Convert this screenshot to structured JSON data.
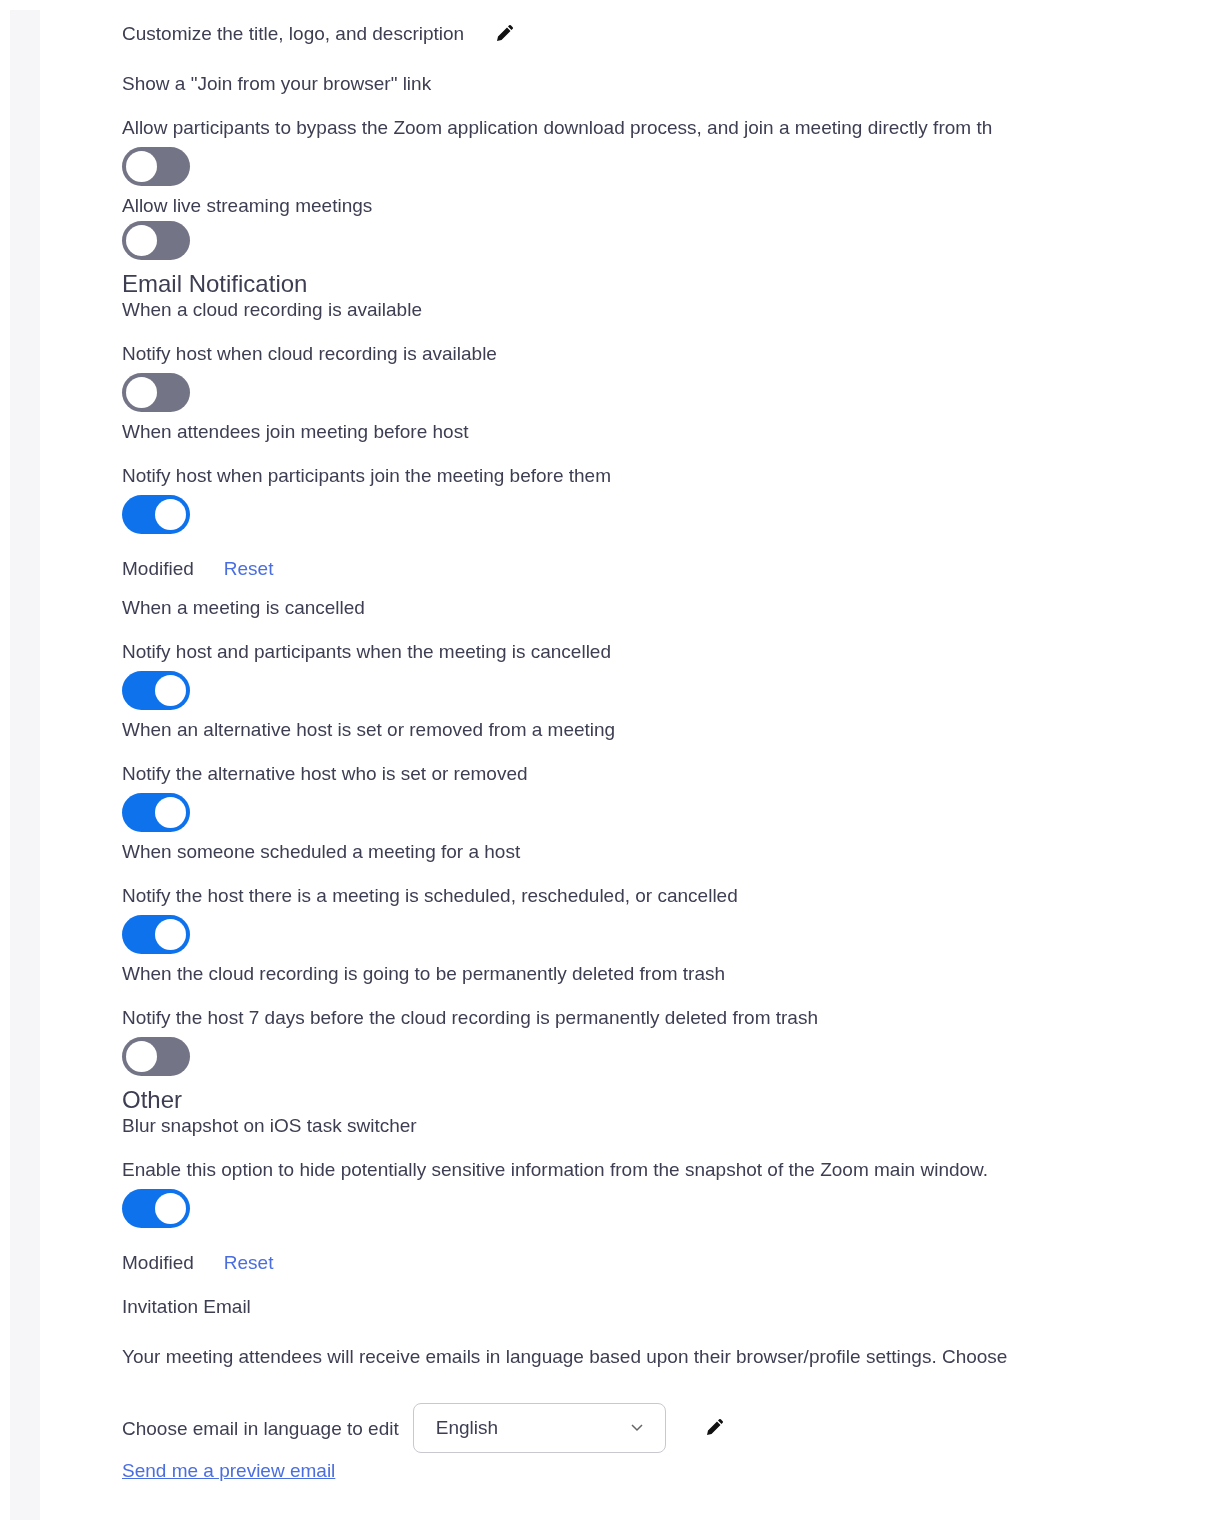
{
  "items": [
    {
      "kind": "edit",
      "title": "Customize the title, logo, and description"
    },
    {
      "kind": "setting",
      "title": "Show a \"Join from your browser\" link",
      "description": "Allow participants to bypass the Zoom application download process, and join a meeting directly from th",
      "on": false
    },
    {
      "kind": "setting",
      "title": "Allow live streaming meetings",
      "on": false
    },
    {
      "kind": "heading",
      "title": "Email Notification"
    },
    {
      "kind": "setting",
      "title": "When a cloud recording is available",
      "description": "Notify host when cloud recording is available",
      "on": false
    },
    {
      "kind": "setting",
      "title": "When attendees join meeting before host",
      "description": "Notify host when participants join the meeting before them",
      "on": true,
      "modified": "Modified",
      "reset": "Reset"
    },
    {
      "kind": "setting",
      "title": "When a meeting is cancelled",
      "description": "Notify host and participants when the meeting is cancelled",
      "on": true
    },
    {
      "kind": "setting",
      "title": "When an alternative host is set or removed from a meeting",
      "description": "Notify the alternative host who is set or removed",
      "on": true
    },
    {
      "kind": "setting",
      "title": "When someone scheduled a meeting for a host",
      "description": "Notify the host there is a meeting is scheduled, rescheduled, or cancelled",
      "on": true
    },
    {
      "kind": "setting",
      "title": "When the cloud recording is going to be permanently deleted from trash",
      "description": "Notify the host 7 days before the cloud recording is permanently deleted from trash",
      "on": false
    },
    {
      "kind": "heading",
      "title": "Other"
    },
    {
      "kind": "setting",
      "title": "Blur snapshot on iOS task switcher",
      "description": "Enable this option to hide potentially sensitive information from the snapshot of the Zoom main window.",
      "on": true,
      "modified": "Modified",
      "reset": "Reset"
    },
    {
      "kind": "language",
      "title": "Invitation Email",
      "description": "Your meeting attendees will receive emails in language based upon their browser/profile settings. Choose",
      "select_label": "Choose email in language to edit",
      "select_value": "English",
      "link": "Send me a preview email"
    }
  ]
}
